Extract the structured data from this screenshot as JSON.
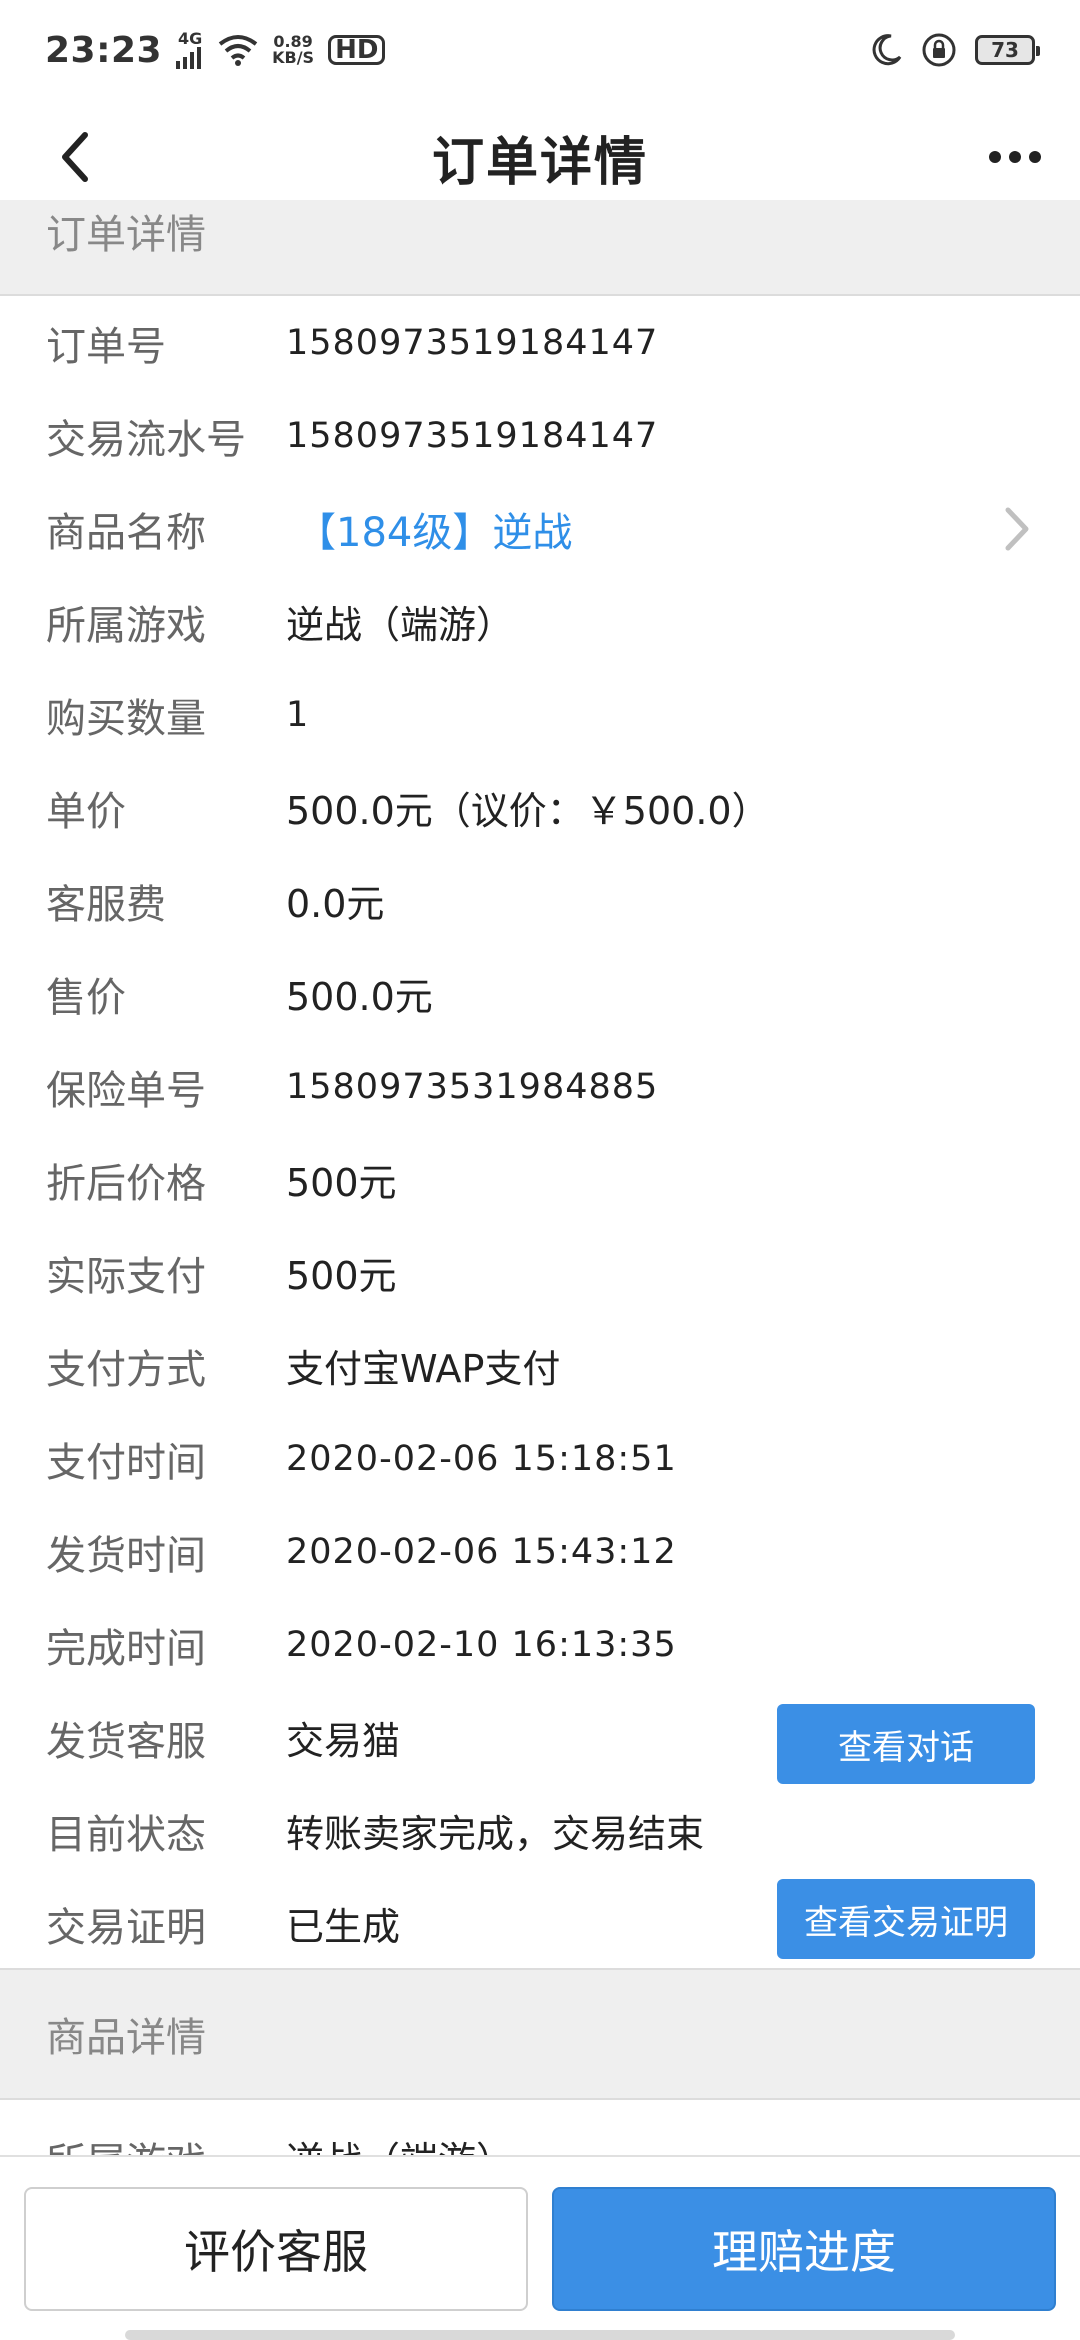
{
  "status_bar": {
    "time": "23:23",
    "network": "4G",
    "speed": "0.89",
    "speed_unit": "KB/S",
    "hd": "HD",
    "battery": "73"
  },
  "header": {
    "title": "订单详情"
  },
  "sections": {
    "order": "订单详情",
    "product": "商品详情"
  },
  "order_rows": [
    {
      "label": "订单号",
      "value": "1580973519184147"
    },
    {
      "label": "交易流水号",
      "value": "1580973519184147"
    },
    {
      "label": "商品名称",
      "value": "【184级】逆战"
    },
    {
      "label": "所属游戏",
      "value": "逆战（端游）"
    },
    {
      "label": "购买数量",
      "value": "1"
    },
    {
      "label": "单价",
      "value": "500.0元（议价：￥500.0）"
    },
    {
      "label": "客服费",
      "value": "0.0元"
    },
    {
      "label": "售价",
      "value": "500.0元"
    },
    {
      "label": "保险单号",
      "value": "1580973531984885"
    },
    {
      "label": "折后价格",
      "value": "500元"
    },
    {
      "label": "实际支付",
      "value": "500元"
    },
    {
      "label": "支付方式",
      "value": "支付宝WAP支付"
    },
    {
      "label": "支付时间",
      "value": "2020-02-06 15:18:51"
    },
    {
      "label": "发货时间",
      "value": "2020-02-06 15:43:12"
    },
    {
      "label": "完成时间",
      "value": "2020-02-10 16:13:35"
    },
    {
      "label": "发货客服",
      "value": "交易猫",
      "button": "查看对话"
    },
    {
      "label": "目前状态",
      "value": "转账卖家完成，交易结束"
    },
    {
      "label": "交易证明",
      "value": "已生成",
      "button": "查看交易证明"
    }
  ],
  "product_rows": [
    {
      "label": "所属游戏",
      "value": "逆战（端游）"
    }
  ],
  "bottom": {
    "left_button": "评价客服",
    "right_button": "理赔进度"
  }
}
